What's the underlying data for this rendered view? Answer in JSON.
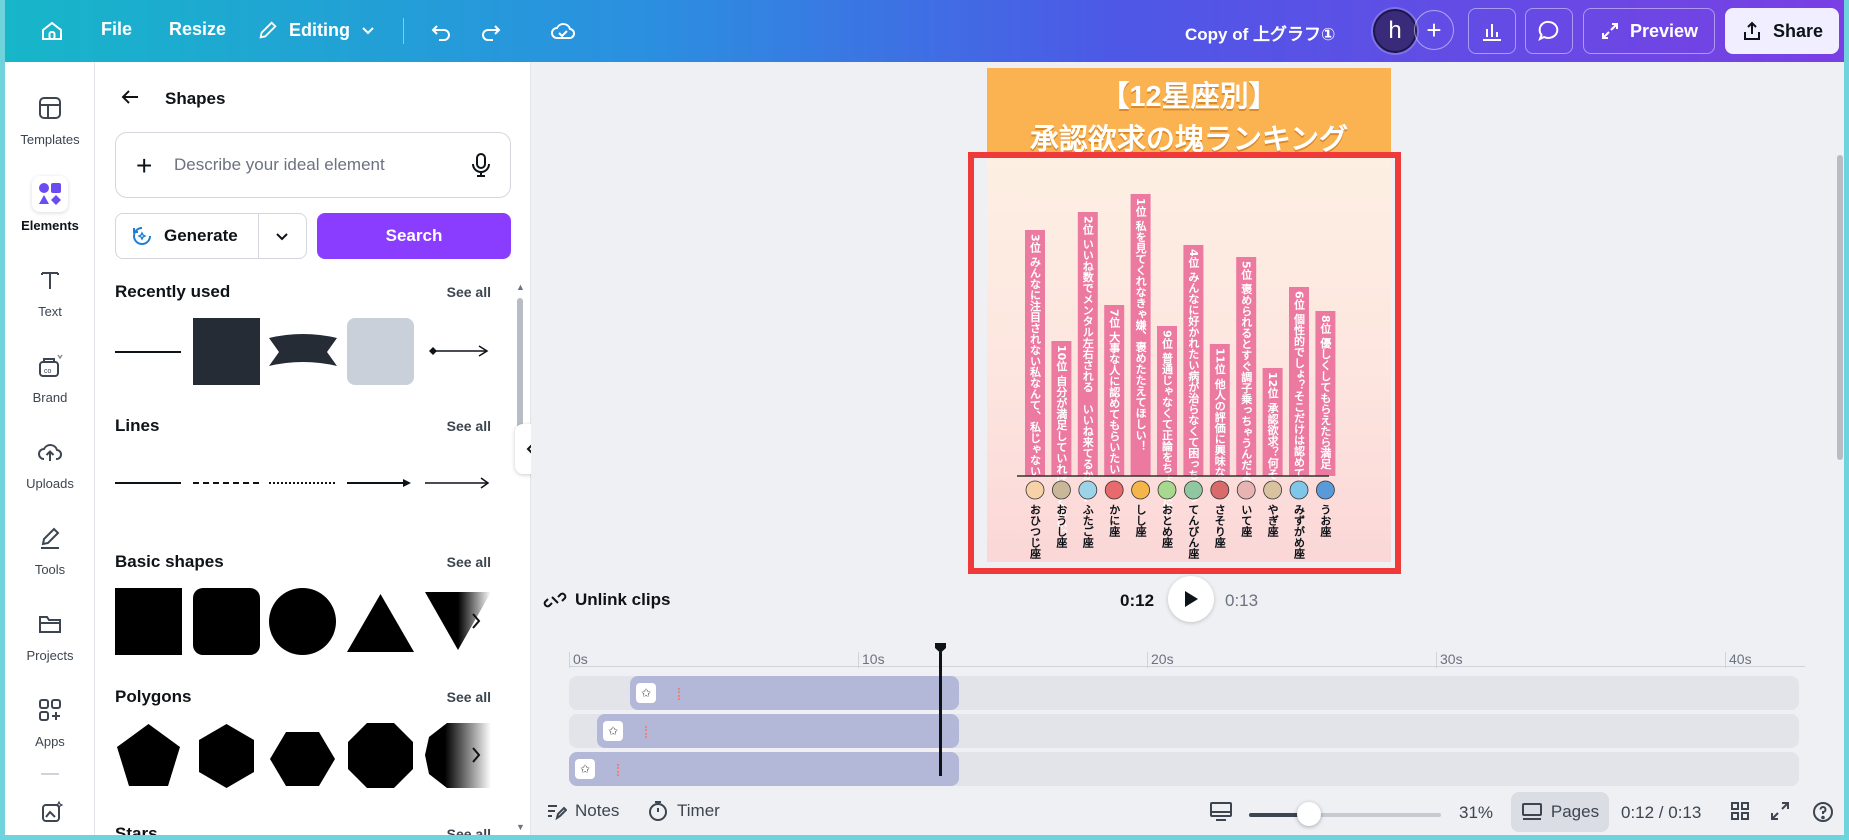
{
  "topbar": {
    "file": "File",
    "resize": "Resize",
    "mode": "Editing",
    "title": "Copy of 上グラフ①",
    "avatar_letter": "h",
    "add_symbol": "+",
    "preview": "Preview",
    "share": "Share"
  },
  "rail": {
    "items": [
      {
        "label": "Templates",
        "icon": "template-icon"
      },
      {
        "label": "Elements",
        "icon": "elements-icon"
      },
      {
        "label": "Text",
        "icon": "text-icon"
      },
      {
        "label": "Brand",
        "icon": "brand-icon"
      },
      {
        "label": "Uploads",
        "icon": "upload-icon"
      },
      {
        "label": "Tools",
        "icon": "tools-icon"
      },
      {
        "label": "Projects",
        "icon": "folder-icon"
      },
      {
        "label": "Apps",
        "icon": "apps-icon"
      }
    ]
  },
  "panel": {
    "title": "Shapes",
    "search_placeholder": "Describe your ideal element",
    "generate": "Generate",
    "search": "Search",
    "see_all": "See all",
    "sections": {
      "recent": "Recently used",
      "lines": "Lines",
      "basic": "Basic shapes",
      "polygons": "Polygons",
      "stars": "Stars"
    }
  },
  "design": {
    "title_line1": "【12星座別】",
    "title_line2": "承認欲求の塊ランキング",
    "bar_color": "#ec7aa0",
    "bars": [
      {
        "rank": "3位",
        "text": "みんなに注目されない私なんて、私じゃない",
        "sign": "おひつじ座",
        "value": 0.82
      },
      {
        "rank": "10位",
        "text": "自分が満足していればよくない？",
        "sign": "おうし座",
        "value": 0.45
      },
      {
        "rank": "2位",
        "text": "いいね数でメンタル左右される　いいね来てるかな…",
        "sign": "ふたご座",
        "value": 0.88
      },
      {
        "rank": "7位",
        "text": "大事な人に認めてもらいたい",
        "sign": "かに座",
        "value": 0.57
      },
      {
        "rank": "1位",
        "text": "私を見てくれなきゃ嫌、褒めたたえてほしい！",
        "sign": "しし座",
        "value": 0.94
      },
      {
        "rank": "9位",
        "text": "普通じゃなくて正論をちょうだい",
        "sign": "おとめ座",
        "value": 0.5
      },
      {
        "rank": "4位",
        "text": "みんなに好かれたい病が治らなくて困っちゃう",
        "sign": "てんびん座",
        "value": 0.77
      },
      {
        "rank": "11位",
        "text": "他人の評価に興味ないわ",
        "sign": "さそり座",
        "value": 0.44
      },
      {
        "rank": "5位",
        "text": "褒められるとすぐ調子乗っちゃうんだよね",
        "sign": "いて座",
        "value": 0.73
      },
      {
        "rank": "12位",
        "text": "承認欲求？何それ？",
        "sign": "やぎ座",
        "value": 0.36
      },
      {
        "rank": "6位",
        "text": "個性的でしょ？そこだけは認めてよ",
        "sign": "みずがめ座",
        "value": 0.63
      },
      {
        "rank": "8位",
        "text": "優しくしてもらえたら満足",
        "sign": "うお座",
        "value": 0.55
      }
    ]
  },
  "playback": {
    "unlink": "Unlink clips",
    "current": "0:12",
    "total": "0:13"
  },
  "timeline": {
    "ticks": [
      "0s",
      "10s",
      "20s",
      "30s",
      "40s"
    ]
  },
  "footer": {
    "notes": "Notes",
    "timer": "Timer",
    "zoom_pct": "31%",
    "zoom_value": 0.31,
    "pages": "Pages",
    "page_count": "0:12 / 0:13"
  }
}
